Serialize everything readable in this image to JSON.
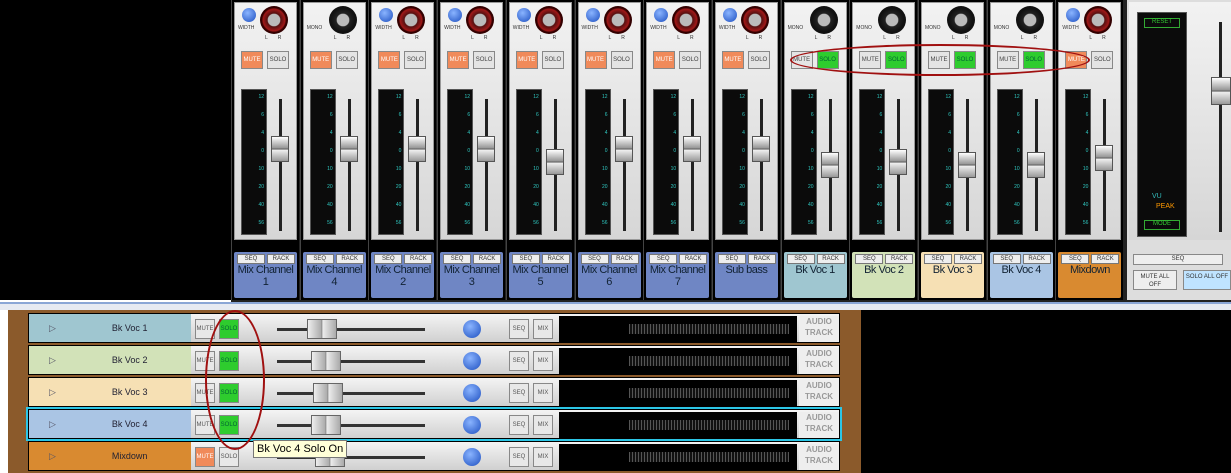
{
  "meter_scale": [
    "12",
    "6",
    "4",
    "0",
    "10",
    "20",
    "40",
    "56"
  ],
  "strip_buttons": {
    "mute": "MUTE",
    "solo": "SOLO",
    "seq": "SEQ",
    "rack": "RACK"
  },
  "channels": [
    {
      "name": "Mix Channel 1",
      "knob": "WIDTH",
      "mute": true,
      "solo": false,
      "color": "#6f86c4",
      "fader": 0.62
    },
    {
      "name": "Mix Channel 4",
      "knob": "MONO",
      "mute": true,
      "solo": false,
      "color": "#6f86c4",
      "fader": 0.62
    },
    {
      "name": "Mix Channel 2",
      "knob": "WIDTH",
      "mute": true,
      "solo": false,
      "color": "#6f86c4",
      "fader": 0.62
    },
    {
      "name": "Mix Channel 3",
      "knob": "WIDTH",
      "mute": true,
      "solo": false,
      "color": "#6f86c4",
      "fader": 0.62
    },
    {
      "name": "Mix Channel 5",
      "knob": "WIDTH",
      "mute": true,
      "solo": false,
      "color": "#6f86c4",
      "fader": 0.52
    },
    {
      "name": "Mix Channel 6",
      "knob": "WIDTH",
      "mute": true,
      "solo": false,
      "color": "#6f86c4",
      "fader": 0.62
    },
    {
      "name": "Mix Channel 7",
      "knob": "WIDTH",
      "mute": true,
      "solo": false,
      "color": "#6f86c4",
      "fader": 0.62
    },
    {
      "name": "Sub bass",
      "knob": "WIDTH",
      "mute": true,
      "solo": false,
      "color": "#6f86c4",
      "fader": 0.62
    },
    {
      "name": "Bk Voc 1",
      "knob": "MONO",
      "mute": false,
      "solo": true,
      "color": "#9fc6d0",
      "fader": 0.5
    },
    {
      "name": "Bk Voc 2",
      "knob": "MONO",
      "mute": false,
      "solo": true,
      "color": "#d2e2b8",
      "fader": 0.52
    },
    {
      "name": "Bk Voc 3",
      "knob": "MONO",
      "mute": false,
      "solo": true,
      "color": "#f6e0b4",
      "fader": 0.5
    },
    {
      "name": "Bk Voc 4",
      "knob": "MONO",
      "mute": false,
      "solo": true,
      "color": "#aac5e4",
      "fader": 0.5
    },
    {
      "name": "Mixdown",
      "knob": "WIDTH",
      "mute": true,
      "solo": false,
      "color": "#d98a30",
      "fader": 0.55
    }
  ],
  "master": {
    "seq": "SEQ",
    "mute_all": "MUTE ALL OFF",
    "solo_all": "SOLO ALL OFF",
    "mode": "MODE",
    "vu": "VU",
    "peak": "PEAK",
    "lcd": "RESET"
  },
  "tracks": [
    {
      "name": "Bk Voc 1",
      "color": "#9fc6d0",
      "mute": false,
      "solo": true,
      "selected": false
    },
    {
      "name": "Bk Voc 2",
      "color": "#d2e2b8",
      "mute": false,
      "solo": true,
      "selected": false
    },
    {
      "name": "Bk Voc 3",
      "color": "#f6e0b4",
      "mute": false,
      "solo": true,
      "selected": false
    },
    {
      "name": "Bk Voc 4",
      "color": "#aac5e4",
      "mute": false,
      "solo": true,
      "selected": true
    },
    {
      "name": "Mixdown",
      "color": "#d98a30",
      "mute": true,
      "solo": false,
      "selected": false
    }
  ],
  "track_buttons": {
    "mute": "MUTE",
    "solo": "SOLO",
    "seq": "SEQ",
    "mix": "MIX",
    "play": "▷",
    "audio_track": "AUDIO TRACK"
  },
  "tooltip": "Bk Voc 4 Solo On"
}
